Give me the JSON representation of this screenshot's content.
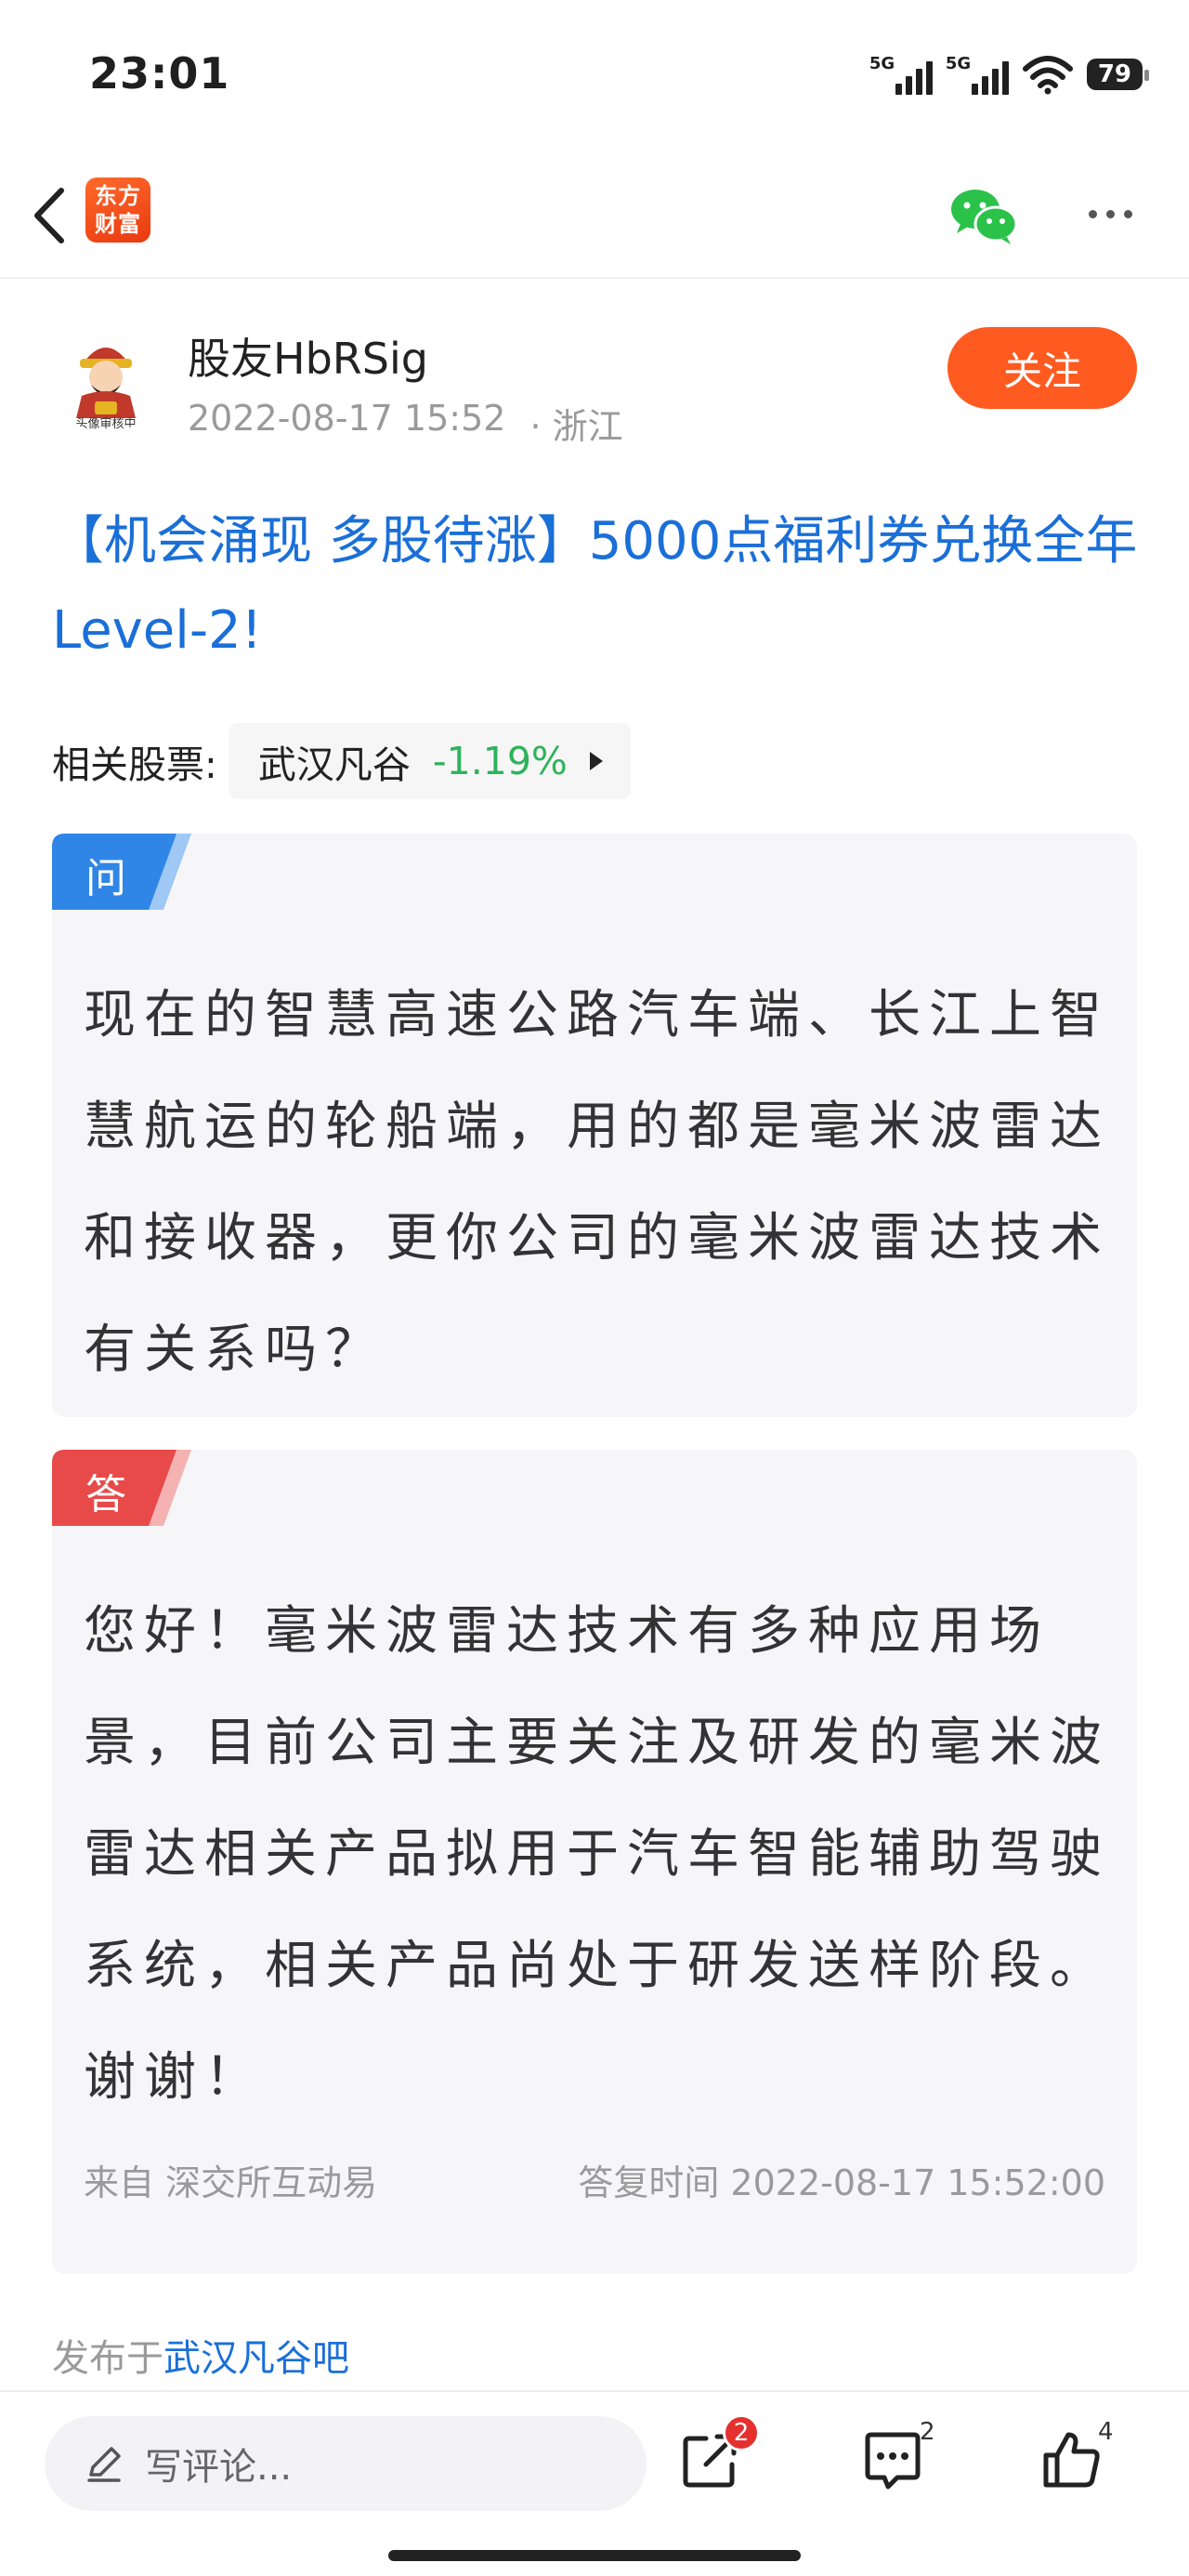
{
  "status": {
    "time": "23:01",
    "net1": "5G",
    "net2": "5G",
    "battery": "79"
  },
  "nav": {
    "logo_line1": "东方",
    "logo_line2": "财富"
  },
  "author": {
    "name": "股友HbRSig",
    "date": "2022-08-17 15:52",
    "location": "· 浙江",
    "follow_label": "关注",
    "avatar_caption": "头像审核中"
  },
  "post": {
    "title": "【机会涌现 多股待涨】5000点福利券兑换全年Level-2!"
  },
  "related": {
    "label": "相关股票:",
    "stock_name": "武汉凡谷",
    "stock_change": "-1.19%"
  },
  "question": {
    "tag": "问",
    "text": "现在的智慧高速公路汽车端、长江上智慧航运的轮船端，用的都是毫米波雷达和接收器，更你公司的毫米波雷达技术有关系吗？"
  },
  "answer": {
    "tag": "答",
    "text": "您好！毫米波雷达技术有多种应用场景，目前公司主要关注及研发的毫米波雷达相关产品拟用于汽车智能辅助驾驶系统，相关产品尚处于研发送样阶段。谢谢！",
    "source": "来自 深交所互动易",
    "reply_time": "答复时间 2022-08-17 15:52:00"
  },
  "published": {
    "prefix": "发布于",
    "bar_name": "武汉凡谷吧"
  },
  "bottom": {
    "comment_placeholder": "写评论...",
    "share_badge": "2",
    "comment_count": "2",
    "like_count": "4"
  },
  "colors": {
    "accent_orange": "#ff5a1f",
    "link_blue": "#1a6fd8",
    "down_green": "#2db35a",
    "question_blue": "#2f86e6",
    "answer_red": "#e84a4a"
  }
}
